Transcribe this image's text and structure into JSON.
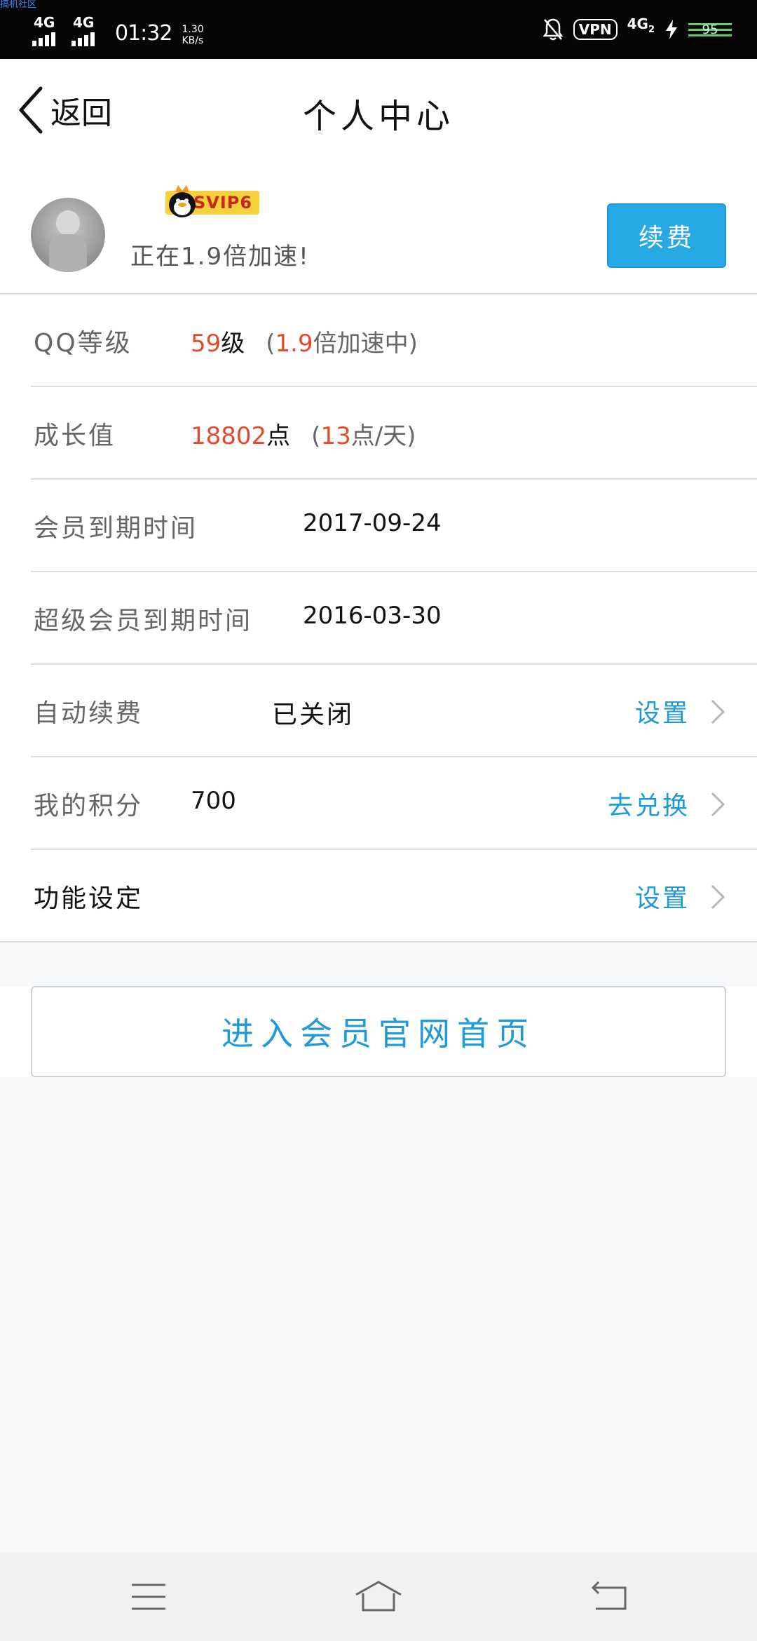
{
  "status_bar": {
    "watermark": "搞机社区",
    "signal1": "4G",
    "signal2": "4G",
    "time": "01:32",
    "speed_value": "1.30",
    "speed_unit": "KB/s",
    "vpn": "VPN",
    "network": "4G",
    "network_sub": "2",
    "battery": "95",
    "icons": [
      "bell-off-icon",
      "lightning-icon",
      "battery-icon"
    ]
  },
  "header": {
    "back_label": "返回",
    "title": "个人中心"
  },
  "profile": {
    "badge": "SVIP6",
    "speed_text": "正在1.9倍加速!",
    "renew_button": "续费"
  },
  "rows": {
    "qq_level": {
      "label": "QQ等级",
      "level_num": "59",
      "level_unit": "级",
      "paren_open": "(",
      "speed_num": "1.9",
      "speed_text": "倍加速中)"
    },
    "growth": {
      "label": "成长值",
      "points_num": "18802",
      "points_unit": "点",
      "paren_open": "(",
      "daily_num": "13",
      "daily_text": "点/天)"
    },
    "member_expiry": {
      "label": "会员到期时间",
      "value": "2017-09-24"
    },
    "svip_expiry": {
      "label": "超级会员到期时间",
      "value": "2016-03-30"
    },
    "auto_renew": {
      "label": "自动续费",
      "value": "已关闭",
      "link": "设置"
    },
    "points": {
      "label": "我的积分",
      "value": "700",
      "link": "去兑换"
    },
    "features": {
      "label": "功能设定",
      "link": "设置"
    }
  },
  "home_button": "进入会员官网首页",
  "colors": {
    "accent": "#1f9ad6",
    "red": "#e24a2c",
    "button": "#27a9e6",
    "badge": "#f6d13b"
  }
}
